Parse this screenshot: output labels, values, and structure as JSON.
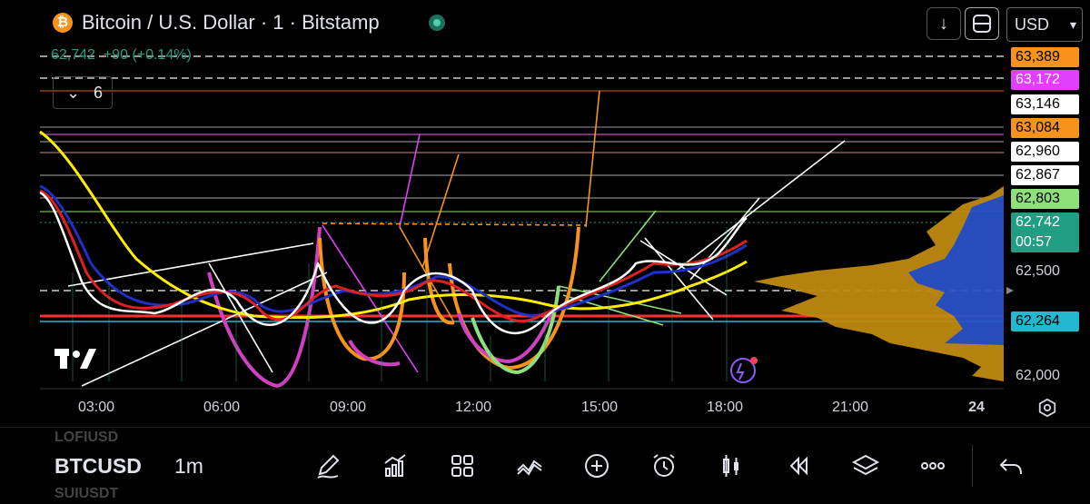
{
  "header": {
    "title": "Bitcoin / U.S. Dollar · 1 · Bitstamp",
    "logo_glyph": "₿",
    "price": "62,742",
    "change": "+90 (+0.14%)",
    "currency": "USD",
    "indicators_count": "6"
  },
  "price_axis": {
    "ticks": [
      "62,500",
      "62,000"
    ],
    "labels": [
      {
        "value": "63,389",
        "color": "#f7931a"
      },
      {
        "value": "63,172",
        "color": "#e040fb"
      },
      {
        "value": "63,146",
        "color": "#ffffff"
      },
      {
        "value": "63,084",
        "color": "#f7931a"
      },
      {
        "value": "62,960",
        "color": "#ffffff"
      },
      {
        "value": "62,867",
        "color": "#ffffff"
      },
      {
        "value": "62,803",
        "color": "#8ee07a"
      },
      {
        "value": "62,742",
        "color": "#1f9e83"
      },
      {
        "value": "62,264",
        "color": "#22b8cf"
      }
    ],
    "countdown": "00:57"
  },
  "time_axis": {
    "labels": [
      "03:00",
      "06:00",
      "09:00",
      "12:00",
      "15:00",
      "18:00",
      "21:00",
      "24"
    ]
  },
  "bottom": {
    "symbol_prev": "LOFIUSD",
    "symbol_current": "BTCUSD",
    "symbol_next": "SUIUSDT",
    "interval": "1m"
  },
  "toolbar_icons": [
    "draw-icon",
    "indicators-icon",
    "grid-icon",
    "trend-icon",
    "add-icon",
    "alarm-icon",
    "candles-icon",
    "replay-icon",
    "layers-icon",
    "more-icon",
    "undo-icon"
  ]
}
